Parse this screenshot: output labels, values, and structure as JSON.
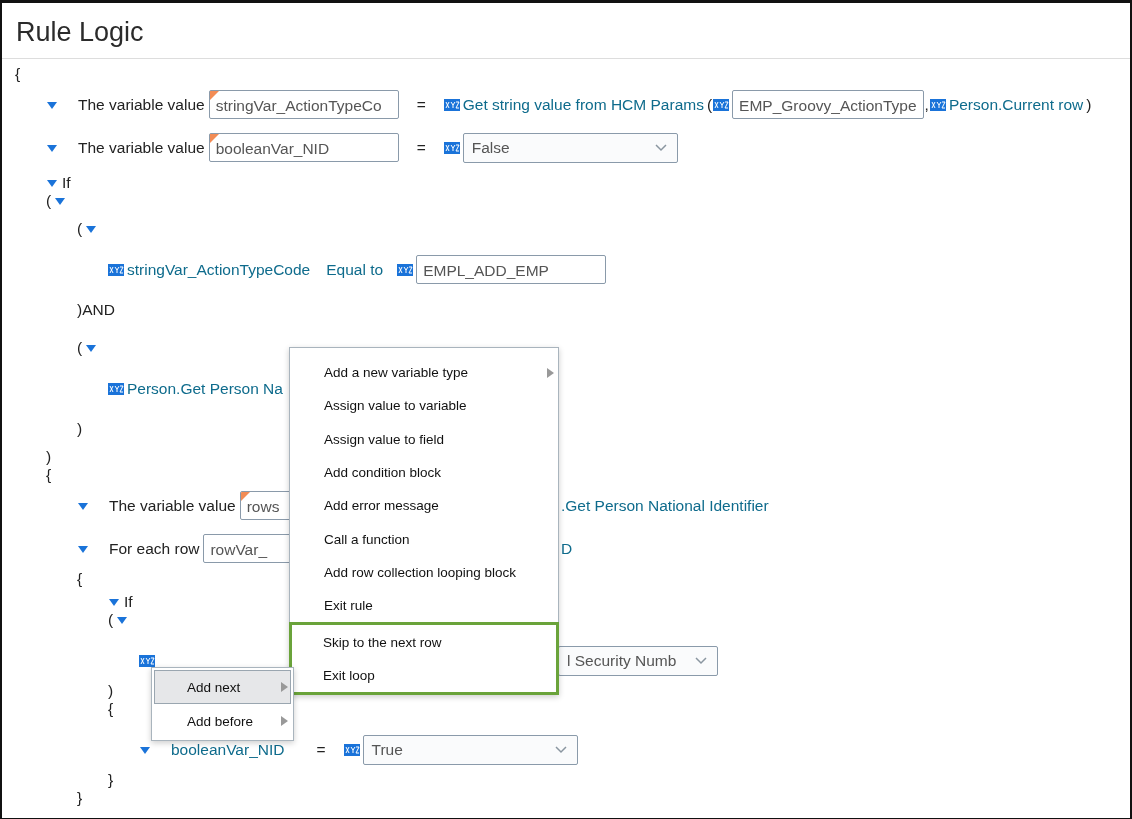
{
  "title": "Rule Logic",
  "tree": [
    {
      "kind": "brace",
      "text": "{"
    },
    {
      "kind": "block",
      "children": [
        {
          "kind": "row",
          "expanded": true,
          "parts": [
            {
              "kind": "label",
              "text": "The variable value"
            },
            {
              "kind": "field",
              "text": "stringVar_ActionTypeCo",
              "marked": true
            },
            {
              "kind": "op",
              "text": "="
            },
            {
              "kind": "ref",
              "text": "Get string value from HCM Params",
              "icon": true
            },
            {
              "kind": "punct",
              "text": "("
            },
            {
              "kind": "field",
              "text": "EMP_Groovy_ActionType",
              "icon": true,
              "marked": false
            },
            {
              "kind": "punct",
              "text": ","
            },
            {
              "kind": "ref",
              "text": "Person.Current row",
              "icon": true
            },
            {
              "kind": "punct",
              "text": ")"
            }
          ]
        },
        {
          "kind": "row",
          "expanded": true,
          "parts": [
            {
              "kind": "label",
              "text": "The variable value"
            },
            {
              "kind": "field",
              "text": "booleanVar_NID",
              "marked": true
            },
            {
              "kind": "op",
              "text": "="
            },
            {
              "kind": "select",
              "text": "False",
              "icon": true
            }
          ]
        },
        {
          "kind": "header",
          "text": "If",
          "expanded": true
        },
        {
          "kind": "toggle",
          "text": "(",
          "expanded": true
        },
        {
          "kind": "block",
          "children": [
            {
              "kind": "tall_toggle",
              "text": "(",
              "expanded": true
            },
            {
              "kind": "block",
              "children": [
                {
                  "kind": "row",
                  "parts": [
                    {
                      "kind": "ref",
                      "text": "stringVar_ActionTypeCode",
                      "icon": true
                    },
                    {
                      "kind": "ref",
                      "text": "Equal to",
                      "icon": false
                    },
                    {
                      "kind": "field",
                      "text": "EMPL_ADD_EMP",
                      "icon": true,
                      "marked": false
                    }
                  ]
                }
              ]
            },
            {
              "kind": "tall_brace",
              "text": ")AND"
            },
            {
              "kind": "tall_toggle",
              "text": "(",
              "expanded": true
            },
            {
              "kind": "block",
              "children": [
                {
                  "kind": "row",
                  "parts": [
                    {
                      "kind": "ref",
                      "text": "Person.Get Person Na",
                      "icon": true
                    }
                  ]
                }
              ]
            },
            {
              "kind": "tall_brace",
              "text": ")"
            }
          ]
        },
        {
          "kind": "brace",
          "text": ")"
        },
        {
          "kind": "brace",
          "text": "{"
        },
        {
          "kind": "block",
          "children": [
            {
              "kind": "row",
              "expanded": true,
              "parts": [
                {
                  "kind": "label",
                  "text": "The variable value"
                },
                {
                  "kind": "wide_field",
                  "text": "rows",
                  "marked": true
                },
                {
                  "kind": "ref",
                  "text": ".Get Person National Identifier",
                  "icon": false
                }
              ]
            },
            {
              "kind": "row",
              "expanded": true,
              "parts": [
                {
                  "kind": "label",
                  "text": "For each row"
                },
                {
                  "kind": "wide_field",
                  "text": "rowVar_",
                  "marked": false
                },
                {
                  "kind": "ref",
                  "text": "D",
                  "icon": false
                }
              ]
            },
            {
              "kind": "brace",
              "text": "{"
            },
            {
              "kind": "block",
              "children": [
                {
                  "kind": "header",
                  "text": "If",
                  "expanded": true
                },
                {
                  "kind": "toggle",
                  "text": "(",
                  "expanded": true
                },
                {
                  "kind": "block",
                  "children": [
                    {
                      "kind": "row",
                      "parts": [
                        {
                          "kind": "icon"
                        },
                        {
                          "kind": "far_select",
                          "text": "l Security Numb"
                        }
                      ]
                    }
                  ]
                },
                {
                  "kind": "brace",
                  "text": ")"
                },
                {
                  "kind": "brace",
                  "text": "{"
                },
                {
                  "kind": "block",
                  "children": [
                    {
                      "kind": "row",
                      "expanded": true,
                      "parts": [
                        {
                          "kind": "ref",
                          "text": "booleanVar_NID",
                          "icon": false
                        },
                        {
                          "kind": "op",
                          "text": "="
                        },
                        {
                          "kind": "select",
                          "text": "True",
                          "icon": true
                        }
                      ]
                    }
                  ]
                },
                {
                  "kind": "brace",
                  "text": "}"
                }
              ]
            },
            {
              "kind": "brace",
              "text": "}"
            }
          ]
        }
      ]
    }
  ],
  "menu": {
    "items": [
      {
        "label": "Add a new variable type",
        "submenu": true,
        "highlighted": false
      },
      {
        "label": "Assign value to variable",
        "submenu": false,
        "highlighted": false
      },
      {
        "label": "Assign value to field",
        "submenu": false,
        "highlighted": false
      },
      {
        "label": "Add condition block",
        "submenu": false,
        "highlighted": false
      },
      {
        "label": "Add error message",
        "submenu": false,
        "highlighted": false
      },
      {
        "label": "Call a function",
        "submenu": false,
        "highlighted": false
      },
      {
        "label": "Add row collection looping block",
        "submenu": false,
        "highlighted": false
      },
      {
        "label": "Exit rule",
        "submenu": false,
        "highlighted": false
      },
      {
        "label": "Skip to the next row",
        "submenu": false,
        "highlighted": true
      },
      {
        "label": "Exit loop",
        "submenu": false,
        "highlighted": true
      }
    ]
  },
  "context_menu": {
    "items": [
      {
        "label": "Add next",
        "submenu": true,
        "selected": true
      },
      {
        "label": "Add before",
        "submenu": true,
        "selected": false
      }
    ]
  }
}
